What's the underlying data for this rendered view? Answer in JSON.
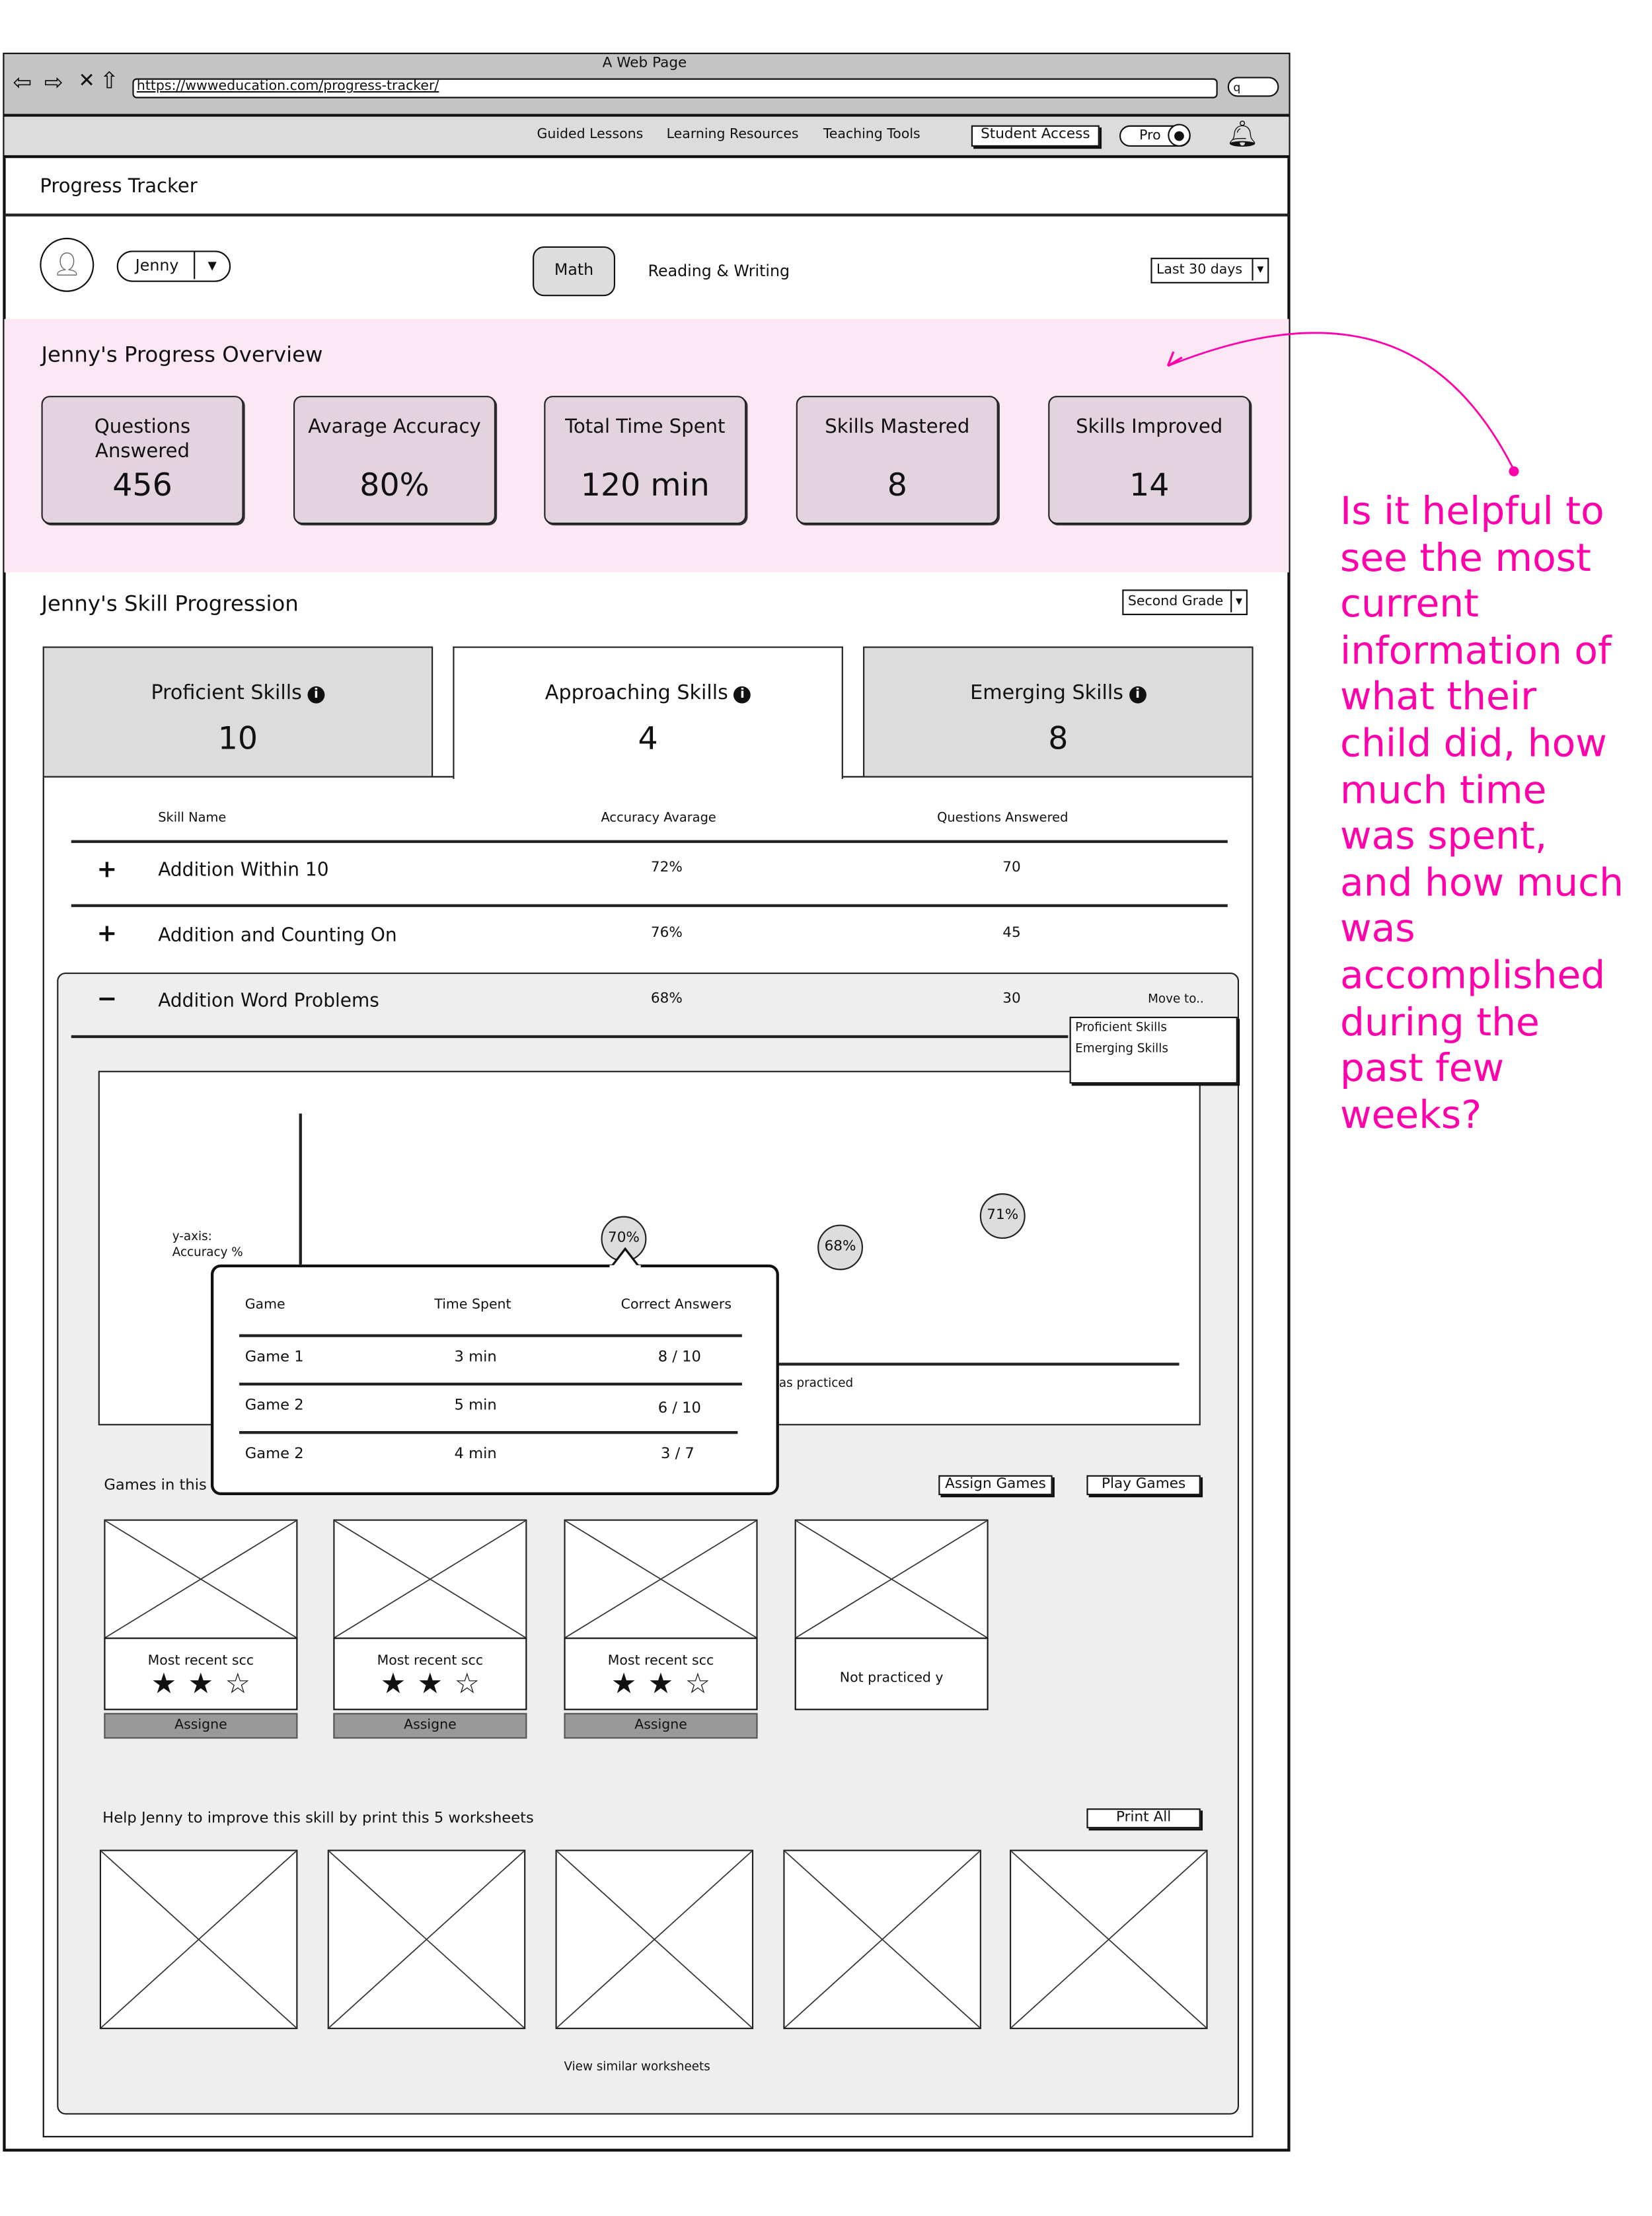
{
  "browser": {
    "title": "A Web Page",
    "url": "https://wwweducation.com/progress-tracker/"
  },
  "nav": {
    "links": [
      "Guided Lessons",
      "Learning Resources",
      "Teaching Tools"
    ],
    "student_access": "Student Access",
    "profile": "Pro"
  },
  "page": {
    "title": "Progress Tracker"
  },
  "filters": {
    "student": "Jenny",
    "subjects": [
      "Math",
      "Reading & Writing"
    ],
    "active_subject": "Math",
    "period": "Last 30 days"
  },
  "overview": {
    "title": "Jenny's Progress Overview",
    "background": "#fce8f4",
    "cards": [
      {
        "label": "Questions Answered",
        "value": "456"
      },
      {
        "label": "Avarage Accuracy",
        "value": "80%"
      },
      {
        "label": "Total Time Spent",
        "value": "120 min"
      },
      {
        "label": "Skills Mastered",
        "value": "8"
      },
      {
        "label": "Skills Improved",
        "value": "14"
      }
    ]
  },
  "progression": {
    "title": "Jenny's Skill Progression",
    "grade": "Second Grade",
    "tabs": [
      {
        "label": "Proficient Skills",
        "value": "10"
      },
      {
        "label": "Approaching Skills",
        "value": "4"
      },
      {
        "label": "Emerging Skills",
        "value": "8"
      }
    ],
    "active_tab": 1,
    "columns": [
      "Skill Name",
      "Accuracy Avarage",
      "Questions Answered"
    ],
    "rows": [
      {
        "toggle": "+",
        "name": "Addition Within 10",
        "accuracy": "72%",
        "questions": "70"
      },
      {
        "toggle": "+",
        "name": "Addition and Counting On",
        "accuracy": "76%",
        "questions": "45"
      },
      {
        "toggle": "−",
        "name": "Addition Word Problems",
        "accuracy": "68%",
        "questions": "30"
      }
    ],
    "move_to": {
      "label": "Move to..",
      "options": [
        "Proficient Skills",
        "Emerging Skills"
      ]
    }
  },
  "chart": {
    "y_label_1": "y-axis:",
    "y_label_2": "Accuracy %",
    "x_label": "as practiced",
    "points": [
      "70%",
      "68%",
      "71%"
    ]
  },
  "popover": {
    "columns": [
      "Game",
      "Time Spent",
      "Correct Answers"
    ],
    "rows": [
      {
        "game": "Game 1",
        "time": "3 min",
        "correct": "8 / 10"
      },
      {
        "game": "Game 2",
        "time": "5 min",
        "correct": "6 / 10"
      },
      {
        "game": "Game 2",
        "time": "4 min",
        "correct": "3 / 7"
      }
    ]
  },
  "games": {
    "title": "Games in this",
    "assign_label": "Assign Games",
    "play_label": "Play Games",
    "items": [
      {
        "caption": "Most recent scc",
        "stars": 2,
        "button": "Assigne"
      },
      {
        "caption": "Most recent scc",
        "stars": 2,
        "button": "Assigne"
      },
      {
        "caption": "Most recent scc",
        "stars": 2,
        "button": "Assigne"
      },
      {
        "caption": "Not practiced y"
      }
    ]
  },
  "worksheets": {
    "title": "Help Jenny to improve this skill by print this 5 worksheets",
    "print_label": "Print All",
    "count": 5,
    "more_link": "View similar worksheets"
  },
  "annotation": {
    "text": "Is it helpful to see the most current information of what their child did, how much time was spent, and how much was accomplished during the past few weeks?",
    "color": "#ff00aa"
  }
}
